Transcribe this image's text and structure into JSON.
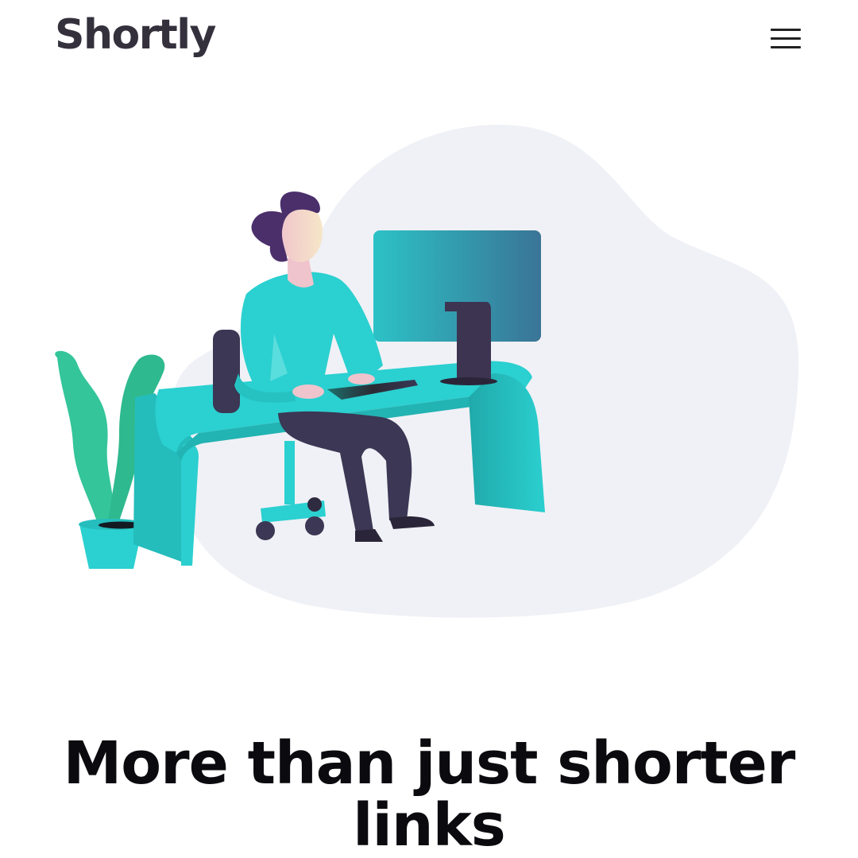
{
  "header": {
    "logo": "Shortly",
    "menu_icon": "hamburger-menu-icon"
  },
  "hero": {
    "illustration": "person-working-at-desk-illustration",
    "title": "More than just shorter links"
  },
  "colors": {
    "brand_dark": "#34313d",
    "accent_cyan": "#2bd0d0",
    "blob": "#f0f1f6",
    "hair_purple": "#4b2f6b",
    "monitor_teal": "#3a7f95",
    "plant_green": "#34c59a",
    "pants_dark": "#3b3754",
    "title_text": "#0b0b0f"
  }
}
